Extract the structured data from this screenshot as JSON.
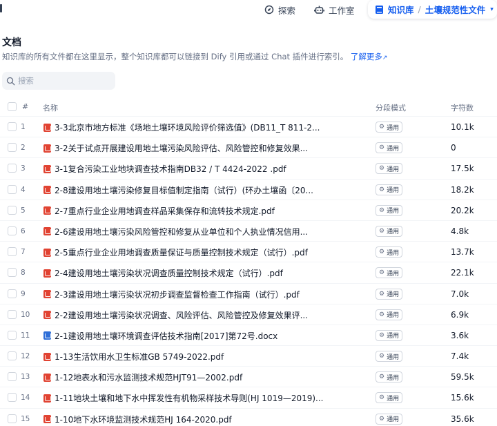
{
  "nav": {
    "explore": "探索",
    "studio": "工作室",
    "knowledge": "知识库",
    "separator": "/",
    "dataset": "土壤规范性文件"
  },
  "header": {
    "title": "文档",
    "description": "知识库的所有文件都在这里显示，整个知识库都可以链接到 Dify 引用或通过 Chat 插件进行索引。",
    "learn_more": "了解更多"
  },
  "search": {
    "placeholder": "搜索"
  },
  "table": {
    "columns": {
      "index": "#",
      "name": "名称",
      "mode": "分段模式",
      "chars": "字符数"
    },
    "rows": [
      {
        "index": "1",
        "name": "3-3北京市地方标准《场地土壤环境风险评价筛选值》(DB11_T 811-2...",
        "type": "pdf",
        "mode": "通用",
        "chars": "10.1k"
      },
      {
        "index": "2",
        "name": "3-2关于试点开展建设用地土壤污染风险评估、风险管控和修复效果...",
        "type": "pdf",
        "mode": "通用",
        "chars": "0"
      },
      {
        "index": "3",
        "name": "3-1复合污染工业地块调查技术指南DB32 / T 4424-2022 .pdf",
        "type": "pdf",
        "mode": "通用",
        "chars": "17.5k"
      },
      {
        "index": "4",
        "name": "2-8建设用地土壤污染修复目标值制定指南（试行）(环办土壤函〔20...",
        "type": "pdf",
        "mode": "通用",
        "chars": "18.2k"
      },
      {
        "index": "5",
        "name": "2-7重点行业企业用地调查样品采集保存和流转技术规定.pdf",
        "type": "pdf",
        "mode": "通用",
        "chars": "20.2k"
      },
      {
        "index": "6",
        "name": "2-6建设用地土壤污染风险管控和修复从业单位和个人执业情况信用...",
        "type": "pdf",
        "mode": "通用",
        "chars": "4.8k"
      },
      {
        "index": "7",
        "name": "2-5重点行业企业用地调查质量保证与质量控制技术规定（试行）.pdf",
        "type": "pdf",
        "mode": "通用",
        "chars": "13.7k"
      },
      {
        "index": "8",
        "name": "2-4建设用地土壤污染状况调查质量控制技术规定（试行）.pdf",
        "type": "pdf",
        "mode": "通用",
        "chars": "22.1k"
      },
      {
        "index": "9",
        "name": "2-3建设用地土壤污染状况初步调查监督检查工作指南（试行）.pdf",
        "type": "pdf",
        "mode": "通用",
        "chars": "7.0k"
      },
      {
        "index": "10",
        "name": "2-2建设用地土壤污染状况调查、风险评估、风险管控及修复效果评...",
        "type": "pdf",
        "mode": "通用",
        "chars": "6.9k"
      },
      {
        "index": "11",
        "name": "2-1建设用地土壤环境调查评估技术指南[2017]第72号.docx",
        "type": "docx",
        "mode": "通用",
        "chars": "3.6k"
      },
      {
        "index": "12",
        "name": "1-13生活饮用水卫生标准GB 5749-2022.pdf",
        "type": "pdf",
        "mode": "通用",
        "chars": "7.4k"
      },
      {
        "index": "13",
        "name": "1-12地表水和污水监测技术规范HJT91—2002.pdf",
        "type": "pdf",
        "mode": "通用",
        "chars": "59.5k"
      },
      {
        "index": "14",
        "name": "1-11地块土壤和地下水中挥发性有机物采样技术导则(HJ 1019—2019)...",
        "type": "pdf",
        "mode": "通用",
        "chars": "15.6k"
      },
      {
        "index": "15",
        "name": "1-10地下水环境监测技术规范HJ 164-2020.pdf",
        "type": "pdf",
        "mode": "通用",
        "chars": "35.6k"
      }
    ]
  },
  "colors": {
    "accent": "#155eef",
    "pdf": "#e14332",
    "docx": "#2f6fd8"
  },
  "icons": {
    "explore": "compass-icon",
    "studio": "robot-icon",
    "knowledge": "book-icon",
    "search": "search-icon",
    "pdf": "pdf-file-icon",
    "docx": "word-file-icon",
    "mode": "gear-icon",
    "external": "external-link-icon"
  }
}
